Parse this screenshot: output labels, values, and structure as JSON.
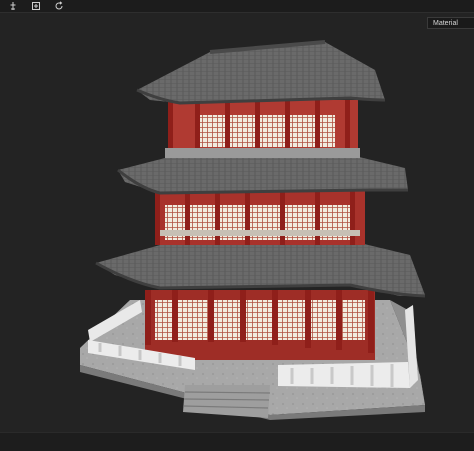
{
  "toolbar": {
    "buttons": [
      {
        "icon": "pin-icon"
      },
      {
        "icon": "import-icon"
      },
      {
        "icon": "reset-view-icon"
      }
    ]
  },
  "material_select": {
    "value": "Material"
  },
  "colors": {
    "background": "#232323",
    "roof": "#6b6b6b",
    "pillar": "#9a2a24",
    "wall": "#b03a32",
    "balustrade": "#e8e8e8",
    "platform": "#a9a9a9"
  }
}
